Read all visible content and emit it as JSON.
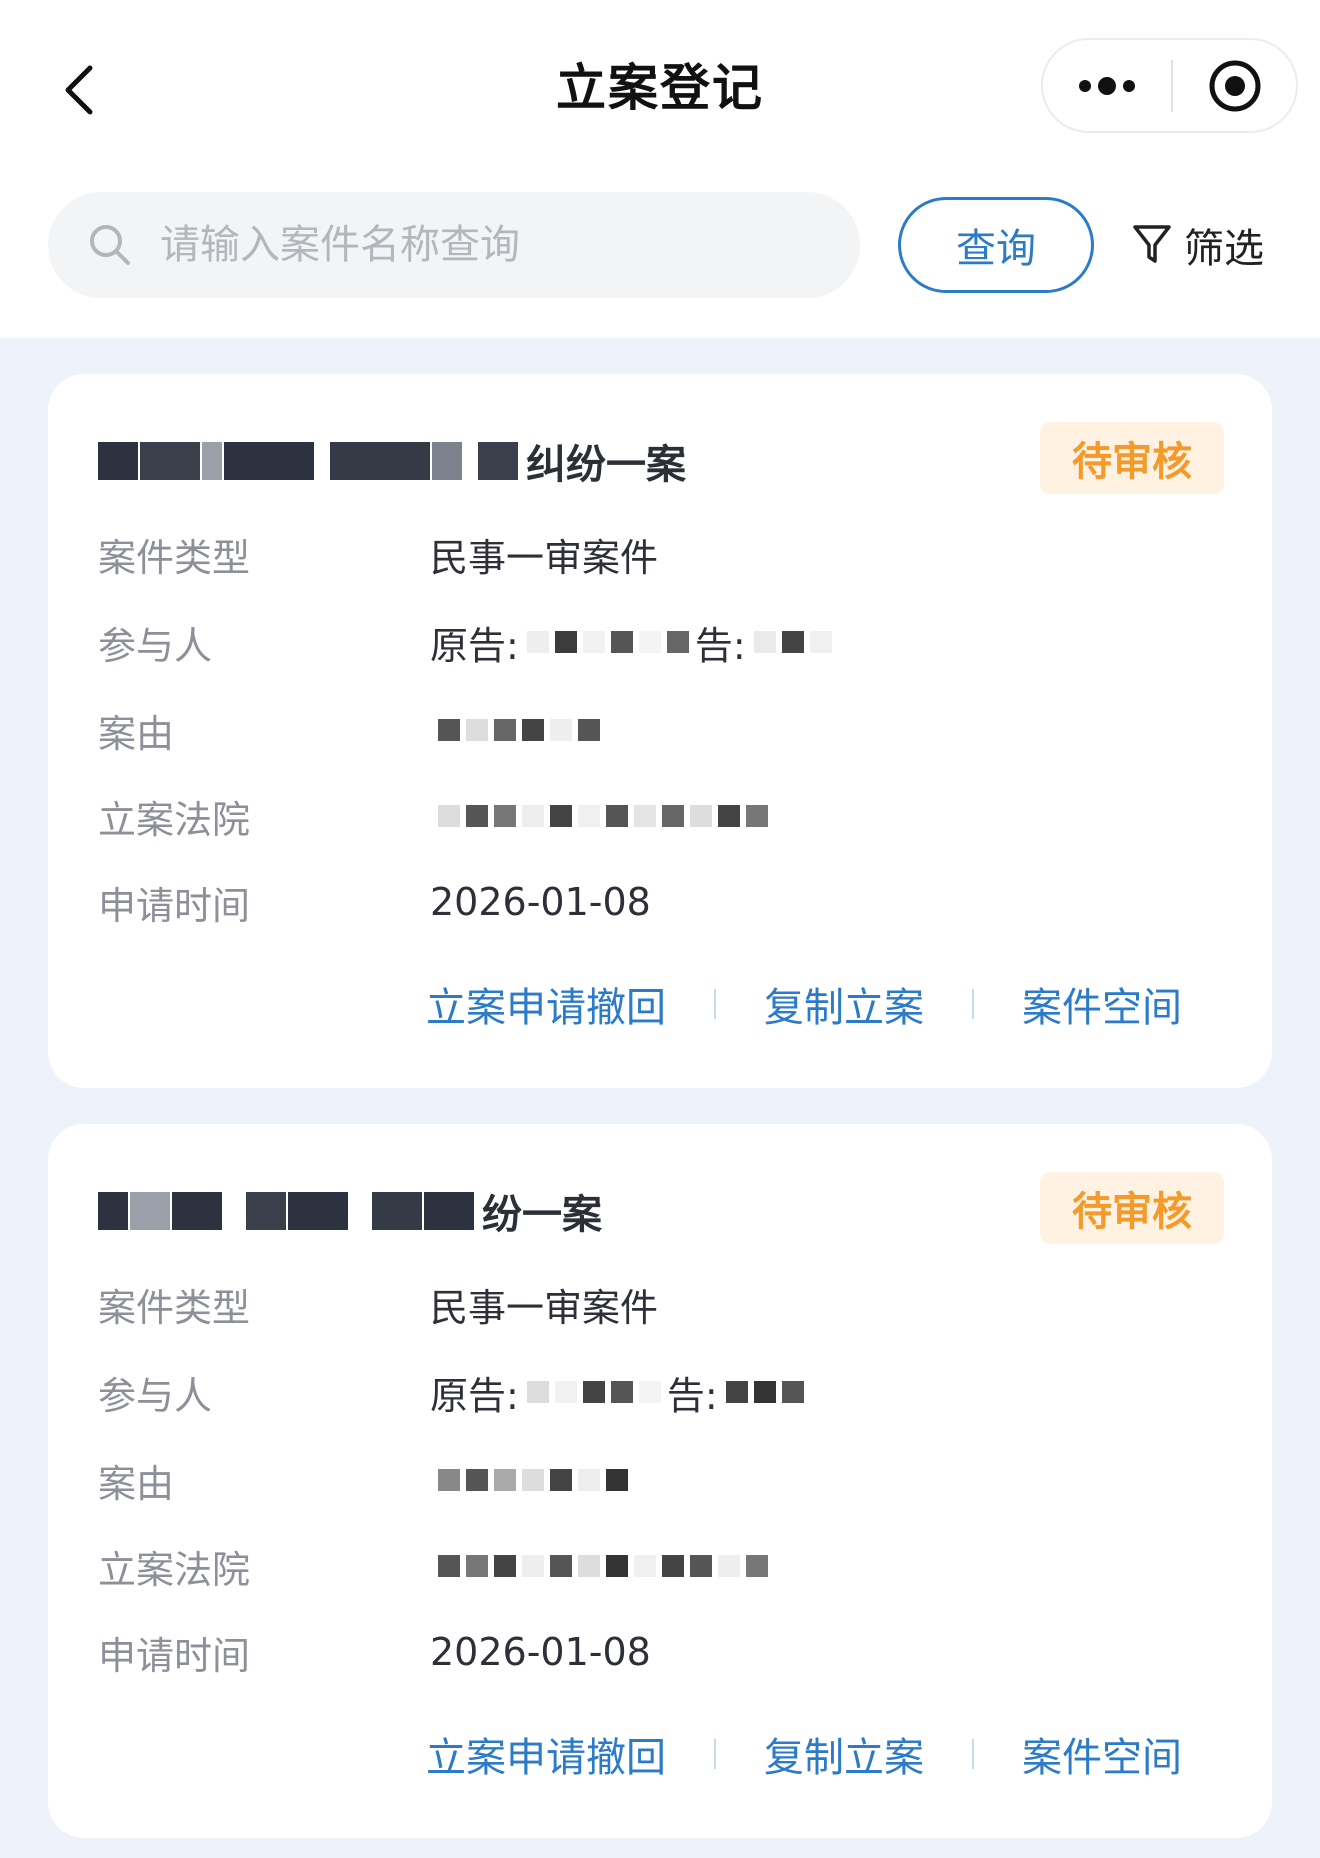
{
  "nav": {
    "title": "立案登记"
  },
  "search": {
    "placeholder": "请输入案件名称查询",
    "query_label": "查询",
    "filter_label": "筛选"
  },
  "labels": {
    "case_type": "案件类型",
    "participants": "参与人",
    "cause": "案由",
    "court": "立案法院",
    "apply_time": "申请时间"
  },
  "cases": [
    {
      "title_suffix": "纠纷一案",
      "status": "待审核",
      "case_type": "民事一审案件",
      "participants_prefix": "原告:",
      "participants_mid": "告:",
      "apply_time": "2026-01-08",
      "actions": [
        "立案申请撤回",
        "复制立案",
        "案件空间"
      ]
    },
    {
      "title_suffix": "纷一案",
      "status": "待审核",
      "case_type": "民事一审案件",
      "participants_prefix": "原告:",
      "participants_mid": "告:",
      "apply_time": "2026-01-08",
      "actions": [
        "立案申请撤回",
        "复制立案",
        "案件空间"
      ]
    }
  ],
  "colors": {
    "accent": "#2b7bc8",
    "badge_text": "#f39a2a",
    "badge_bg": "#fff2e2",
    "page_bg": "#eef2fa"
  },
  "icons": {
    "back": "chevron-left-icon",
    "more": "more-dots-icon",
    "close": "target-circle-icon",
    "search": "search-icon",
    "filter": "funnel-icon"
  }
}
